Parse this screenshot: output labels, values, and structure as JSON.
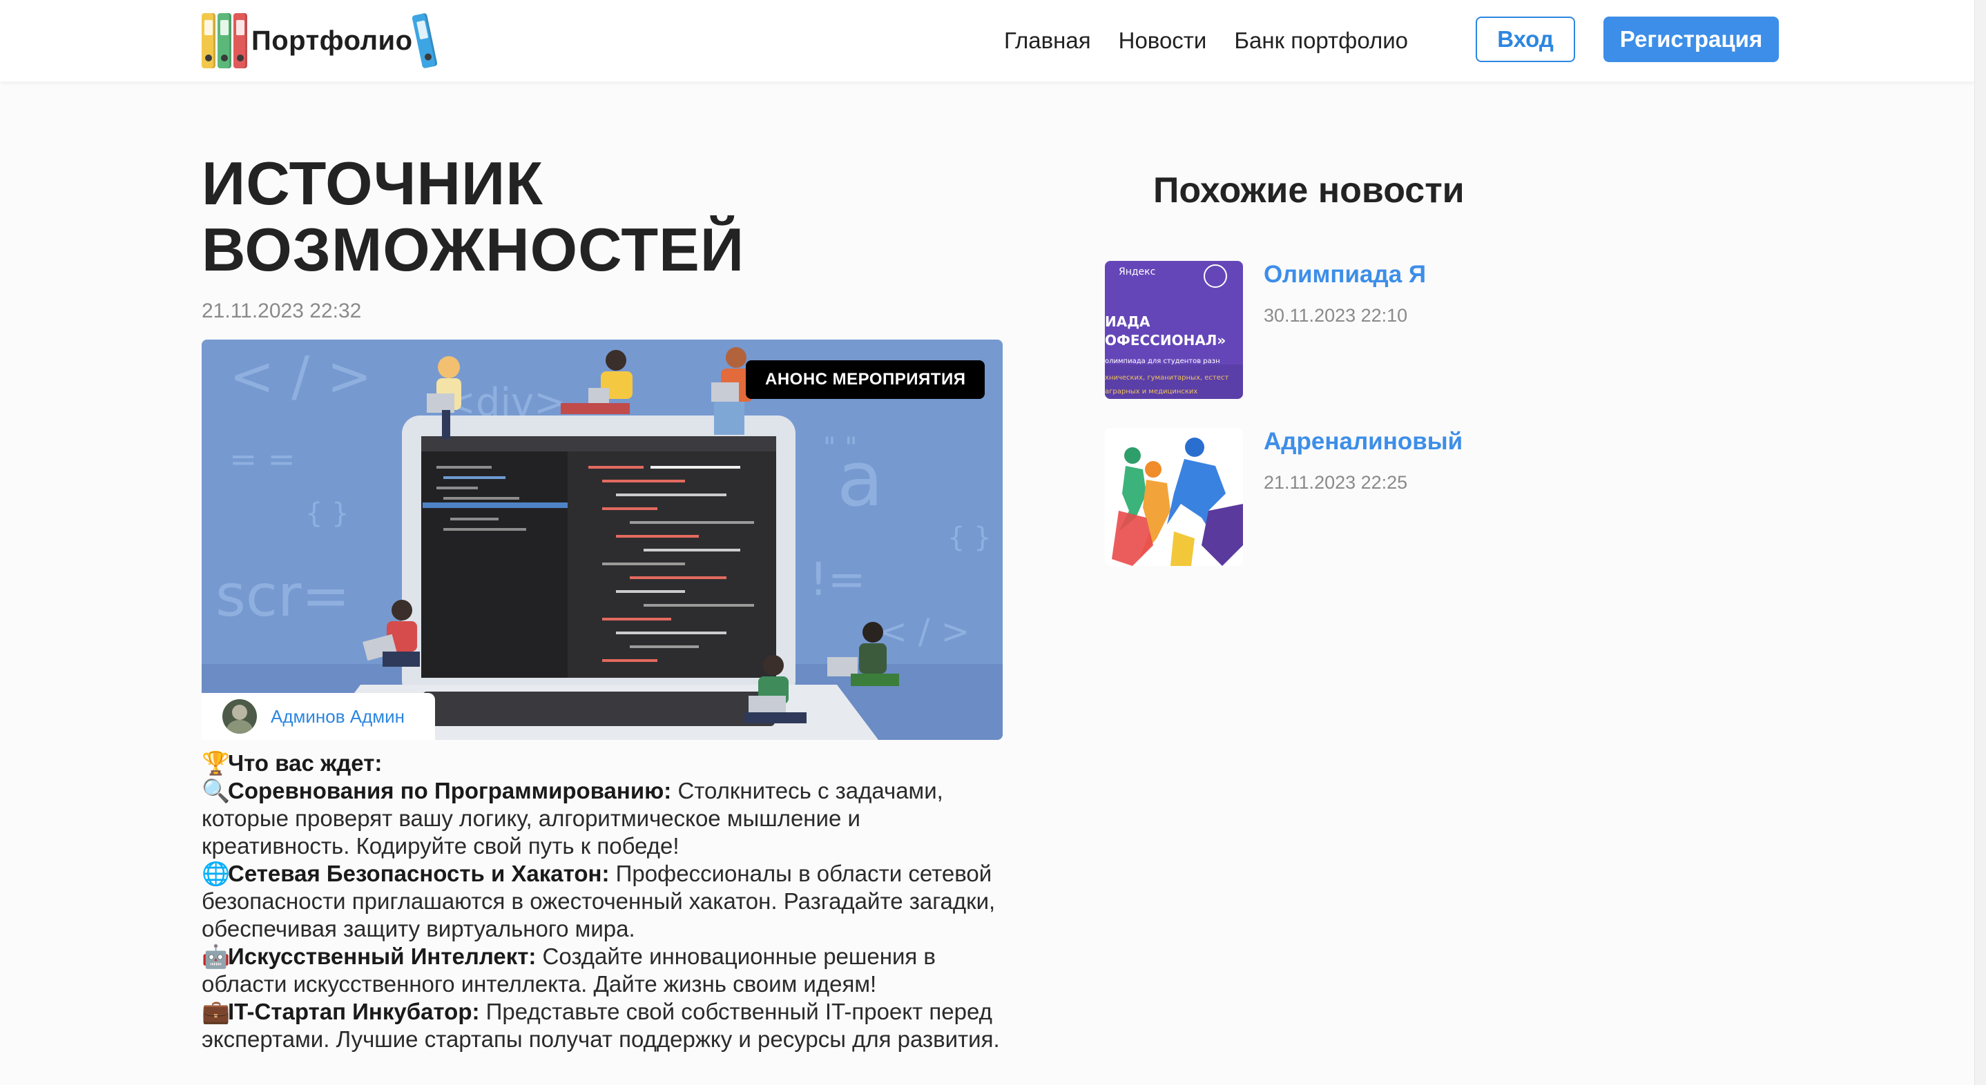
{
  "header": {
    "logo_text": "Портфолио",
    "nav": [
      "Главная",
      "Новости",
      "Банк портфолио"
    ],
    "login_label": "Вход",
    "register_label": "Регистрация"
  },
  "article": {
    "title": "ИСТОЧНИК ВОЗМОЖНОСТЕЙ",
    "date": "21.11.2023 22:32",
    "badge": "АНОНС МЕРОПРИЯТИЯ",
    "author": "Админов Админ",
    "paragraphs": [
      {
        "icon": "trophy-icon",
        "glyph": "🏆",
        "bold": "Что вас ждет:",
        "text": ""
      },
      {
        "icon": "magnifier-icon",
        "glyph": "🔍",
        "bold": "Соревнования по Программированию:",
        "text": " Столкнитесь с задачами, которые проверят вашу логику, алгоритмическое мышление и креативность. Кодируйте свой путь к победе!"
      },
      {
        "icon": "globe-icon",
        "glyph": "🌐",
        "bold": "Сетевая Безопасность и Хакатон:",
        "text": " Профессионалы в области сетевой безопасности приглашаются в ожесточенный хакатон. Разгадайте загадки, обеспечивая защиту виртуального мира."
      },
      {
        "icon": "robot-icon",
        "glyph": "🤖",
        "bold": "Искусственный Интеллект:",
        "text": " Создайте инновационные решения в области искусственного интеллекта. Дайте жизнь своим идеям!"
      },
      {
        "icon": "briefcase-icon",
        "glyph": "💼",
        "bold": "IT-Стартап Инкубатор:",
        "text": " Представьте свой собственный IT-проект перед экспертами. Лучшие стартапы получат поддержку и ресурсы для развития."
      }
    ]
  },
  "related": {
    "title": "Похожие новости",
    "items": [
      {
        "title": "Олимпиада Я",
        "date": "30.11.2023 22:10",
        "thumb_lines": [
          "Яндекс",
          "ИАДА",
          "ОФЕССИОНАЛ»",
          "олимпиада для студентов разн",
          "хнических, гуманитарных, естест",
          "аграрных и медицинских"
        ]
      },
      {
        "title": "Адреналиновый",
        "date": "21.11.2023 22:25"
      }
    ]
  },
  "hero_text": {
    "tag_open": "< / >",
    "div_tag": "<div>",
    "eq": "= =",
    "braces": "{ }",
    "scr": "scr=",
    "neq": "!=",
    "a": "a",
    "quotes": "\" \"",
    "close_tag": "< / >"
  },
  "colors": {
    "accent": "#3d8ee8",
    "hero_bg": "#7699d0",
    "badge_bg": "#000000"
  }
}
